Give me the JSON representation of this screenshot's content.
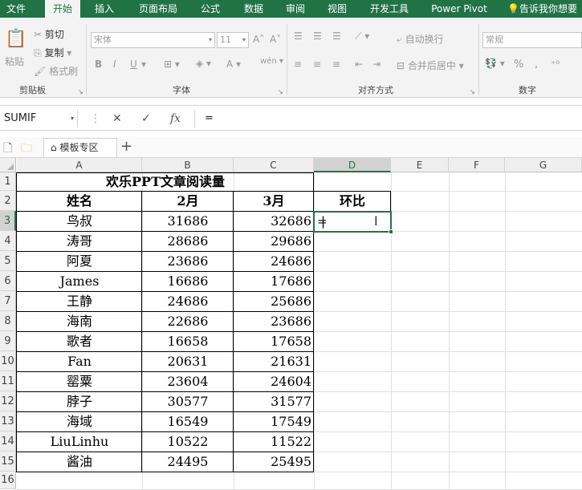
{
  "ribbon_tabs": [
    "文件",
    "开始",
    "插入",
    "页面布局",
    "公式",
    "数据",
    "审阅",
    "视图",
    "开发工具",
    "Power Pivot"
  ],
  "tell_me": "告诉我你想要",
  "clipboard": {
    "paste": "粘贴",
    "cut": "剪切",
    "copy": "复制",
    "format_painter": "格式刷",
    "group": "剪贴板"
  },
  "font": {
    "name": "宋体",
    "size": "11",
    "group": "字体",
    "bold": "B",
    "italic": "I",
    "underline": "U"
  },
  "alignment": {
    "wrap": "自动换行",
    "merge": "合并后居中",
    "group": "对齐方式"
  },
  "number": {
    "format": "常规",
    "percent": "%",
    "comma": ",",
    "group": "数字"
  },
  "formula_bar": {
    "name_box": "SUMIF",
    "cancel": "✕",
    "enter": "✓",
    "fx": "fx",
    "formula": "="
  },
  "sheet_strip": {
    "tab_label": "模板专区",
    "add": "+"
  },
  "columns": [
    "A",
    "B",
    "C",
    "D",
    "E",
    "F",
    "G"
  ],
  "rows": [
    "1",
    "2",
    "3",
    "4",
    "5",
    "6",
    "7",
    "8",
    "9",
    "10",
    "11",
    "12",
    "13",
    "14",
    "15",
    "16"
  ],
  "table": {
    "title": "欢乐PPT文章阅读量",
    "headers": [
      "姓名",
      "2月",
      "3月",
      "环比"
    ],
    "data": [
      [
        "鸟叔",
        "31686",
        "32686"
      ],
      [
        "涛哥",
        "28686",
        "29686"
      ],
      [
        "阿夏",
        "23686",
        "24686"
      ],
      [
        "James",
        "16686",
        "17686"
      ],
      [
        "王静",
        "24686",
        "25686"
      ],
      [
        "海南",
        "22686",
        "23686"
      ],
      [
        "歌者",
        "16658",
        "17658"
      ],
      [
        "Fan",
        "20631",
        "21631"
      ],
      [
        "罂粟",
        "23604",
        "24604"
      ],
      [
        "脖子",
        "30577",
        "31577"
      ],
      [
        "海域",
        "16549",
        "17549"
      ],
      [
        "LiuLinhu",
        "10522",
        "11522"
      ],
      [
        "酱油",
        "24495",
        "25495"
      ]
    ],
    "editing_value": "="
  },
  "colors": {
    "accent": "#217346"
  }
}
